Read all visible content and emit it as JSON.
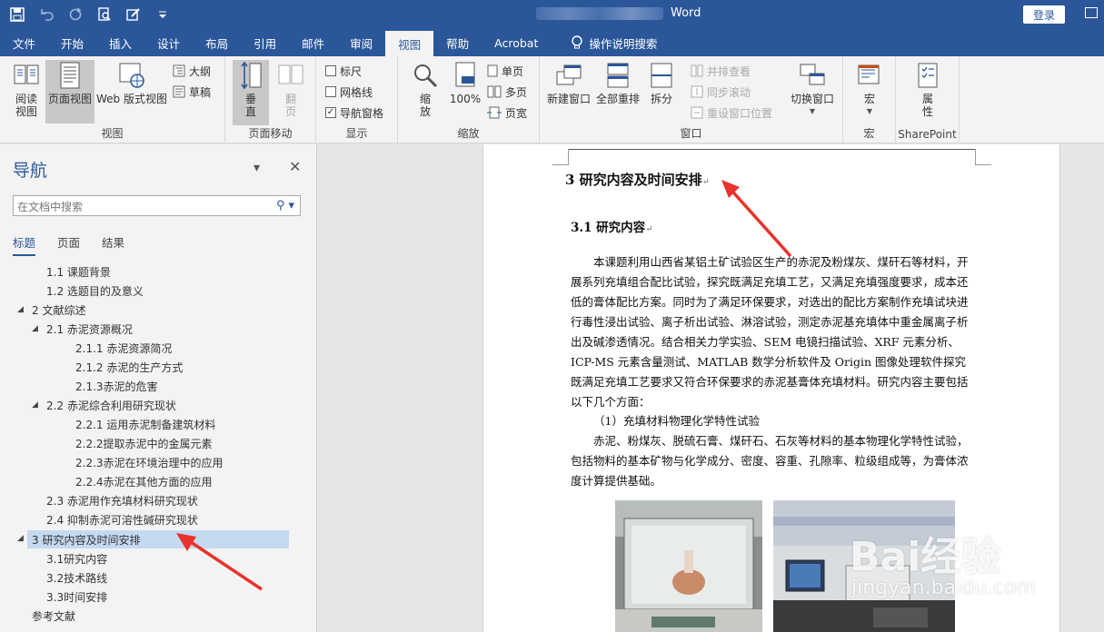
{
  "titlebar": {
    "doc_title": "Word",
    "login_label": "登录"
  },
  "tabs": [
    {
      "label": "文件"
    },
    {
      "label": "开始"
    },
    {
      "label": "插入"
    },
    {
      "label": "设计"
    },
    {
      "label": "布局"
    },
    {
      "label": "引用"
    },
    {
      "label": "邮件"
    },
    {
      "label": "审阅"
    },
    {
      "label": "视图"
    },
    {
      "label": "帮助"
    },
    {
      "label": "Acrobat"
    }
  ],
  "tell_me": "操作说明搜索",
  "ribbon": {
    "views": {
      "read": "阅读\n视图",
      "print": "页面视图",
      "web": "Web 版式视图",
      "outline": "大纲",
      "draft": "草稿",
      "label": "视图"
    },
    "page_move": {
      "vertical": "垂\n直",
      "side": "翻\n页",
      "label": "页面移动"
    },
    "show": {
      "ruler": "标尺",
      "gridlines": "网格线",
      "nav_pane": "导航窗格",
      "label": "显示"
    },
    "zoom": {
      "zoom": "缩\n放",
      "percent": "100%",
      "one_page": "单页",
      "multi_page": "多页",
      "page_width": "页宽",
      "label": "缩放"
    },
    "window": {
      "new_window": "新建窗口",
      "arrange_all": "全部重排",
      "split": "拆分",
      "side_by_side": "并排查看",
      "sync_scroll": "同步滚动",
      "reset_pos": "重设窗口位置",
      "switch": "切换窗口",
      "label": "窗口"
    },
    "macros": {
      "macro": "宏",
      "label": "宏"
    },
    "sharepoint": {
      "props": "属\n性",
      "label": "SharePoint"
    }
  },
  "nav": {
    "title": "导航",
    "search_placeholder": "在文档中搜索",
    "tabs": [
      "标题",
      "页面",
      "结果"
    ],
    "items": [
      {
        "text": "1.1 课题背景"
      },
      {
        "text": "1.2 选题目的及意义"
      },
      {
        "text": "2 文献综述"
      },
      {
        "text": "2.1 赤泥资源概况"
      },
      {
        "text": "2.1.1 赤泥资源简况"
      },
      {
        "text": "2.1.2 赤泥的生产方式"
      },
      {
        "text": "2.1.3赤泥的危害"
      },
      {
        "text": "2.2 赤泥综合利用研究现状"
      },
      {
        "text": "2.2.1 运用赤泥制备建筑材料"
      },
      {
        "text": "2.2.2提取赤泥中的金属元素"
      },
      {
        "text": "2.2.3赤泥在环境治理中的应用"
      },
      {
        "text": "2.2.4赤泥在其他方面的应用"
      },
      {
        "text": "2.3 赤泥用作充填材料研究现状"
      },
      {
        "text": "2.4 抑制赤泥可溶性碱研究现状"
      },
      {
        "text": "3 研究内容及时间安排"
      },
      {
        "text": "3.1研究内容"
      },
      {
        "text": "3.2技术路线"
      },
      {
        "text": "3.3时间安排"
      },
      {
        "text": "参考文献"
      }
    ]
  },
  "document": {
    "header_text": "...",
    "h1": "3  研究内容及时间安排",
    "h2": "3.1 研究内容",
    "p1": "本课题利用山西省某铝土矿试验区生产的赤泥及粉煤灰、煤矸石等材料，开展系列充填组合配比试验，探究既满足充填工艺，又满足充填强度要求，成本还低的膏体配比方案。同时为了满足环保要求，对选出的配比方案制作充填试块进行毒性浸出试验、离子析出试验、淋溶试验，测定赤泥基充填体中重金属离子析出及碱渗透情况。结合相关力学实验、SEM 电镜扫描试验、XRF 元素分析、ICP-MS 元素含量测试、MATLAB 数学分析软件及 Origin 图像处理软件探究既满足充填工艺要求又符合环保要求的赤泥基膏体充填材料。研究内容主要包括以下几个方面：",
    "p2": "（1）充填材料物理化学特性试验",
    "p3": "赤泥、粉煤灰、脱硫石膏、煤矸石、石灰等材料的基本物理化学特性试验，包括物料的基本矿物与化学成分、密度、容重、孔隙率、粒级组成等，为膏体浓度计算提供基础。"
  },
  "watermark": {
    "main": "Bai经验",
    "sub": "jingyan.baidu.com"
  },
  "colors": {
    "brand": "#2b579a",
    "selection": "#c5d9f1",
    "arrow": "#e8322b"
  }
}
